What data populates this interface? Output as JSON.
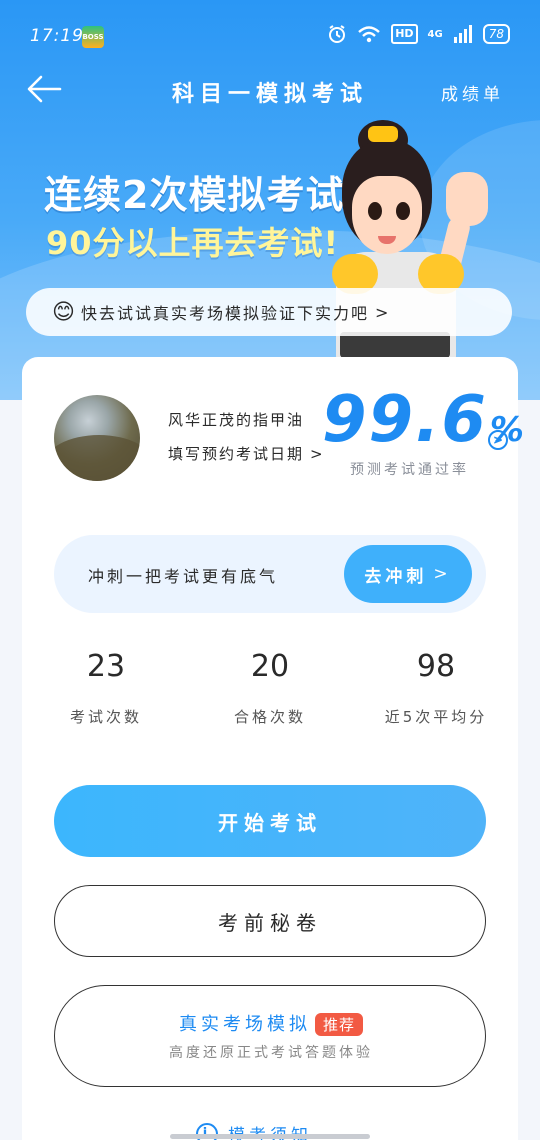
{
  "status_bar": {
    "time": "17:19",
    "app_badge_label": "BOSS",
    "network_type": "4G",
    "hd_label": "HD",
    "battery": "78"
  },
  "nav": {
    "title": "科目一模拟考试",
    "scores_link": "成绩单"
  },
  "hero": {
    "headline_line1": "连续2次模拟考试",
    "headline_line2": "90分以上再去考试!",
    "tip_text": "快去试试真实考场模拟验证下实力吧",
    "tip_chevron": ">"
  },
  "profile": {
    "nickname": "风华正茂的指甲油",
    "fill_exam_date": "填写预约考试日期",
    "fill_chevron": ">"
  },
  "prediction": {
    "pass_rate_value": "99.6",
    "pass_rate_unit": "%",
    "pass_rate_label": "预测考试通过率",
    "arrow": ">"
  },
  "sprint": {
    "text": "冲刺一把考试更有底气",
    "button_label": "去冲刺",
    "button_chevron": ">"
  },
  "stats": [
    {
      "value": "23",
      "label": "考试次数"
    },
    {
      "value": "20",
      "label": "合格次数"
    },
    {
      "value": "98",
      "label": "近5次平均分"
    }
  ],
  "actions": {
    "start_label": "开始考试",
    "secret_label": "考前秘卷",
    "real_exam_title": "真实考场模拟",
    "real_exam_tag": "推荐",
    "real_exam_subtitle": "高度还原正式考试答题体验",
    "notice_label": "模考须知",
    "notice_icon_glyph": "i"
  },
  "colors": {
    "primary_blue": "#1e8bf2",
    "button_blue": "#3fb0fb",
    "headline_yellow": "#fff59a",
    "tag_red": "#f25a43"
  },
  "icons": [
    "back-arrow-icon",
    "alarm-icon",
    "wifi-icon",
    "signal-icon",
    "battery-icon",
    "smile-emoji-icon",
    "chevron-right-icon",
    "info-icon"
  ]
}
